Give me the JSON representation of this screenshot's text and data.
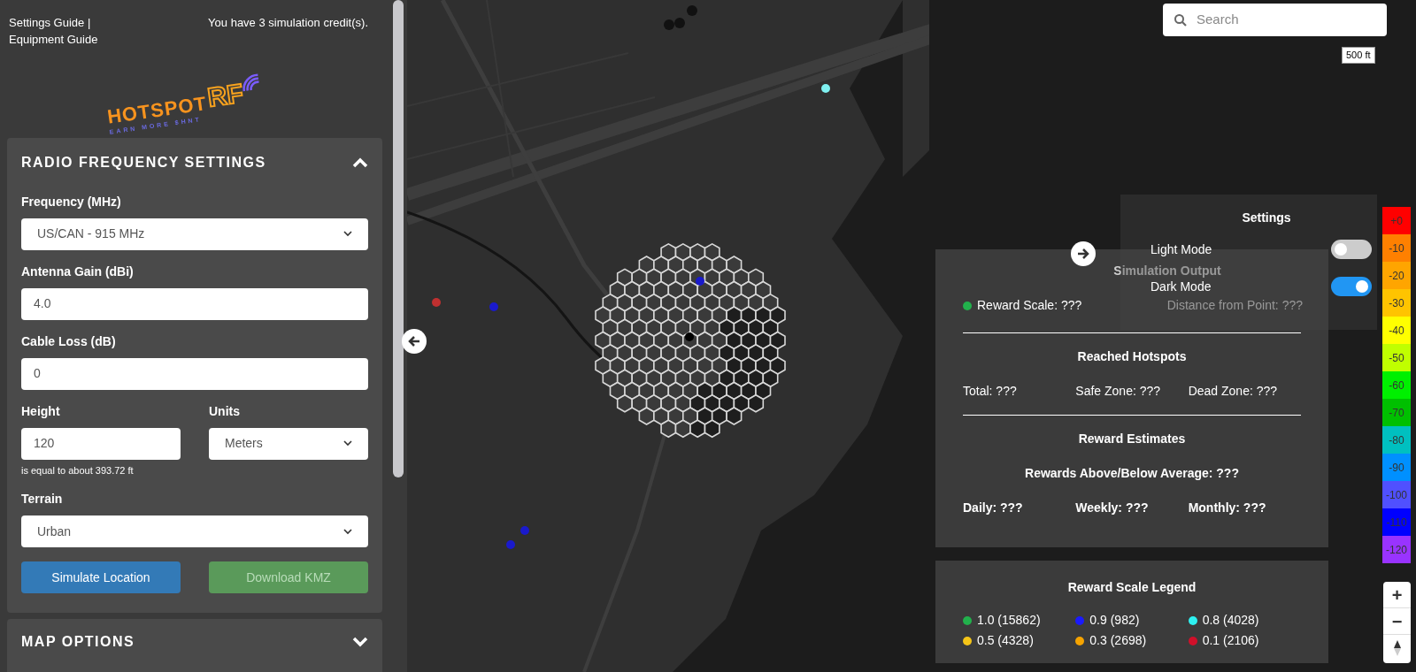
{
  "header": {
    "links": [
      "Settings Guide",
      "Equipment Guide"
    ],
    "separator": "|",
    "credits": "You have 3 simulation credit(s)."
  },
  "logo": {
    "word": "HOTSPOT",
    "accent": "RF",
    "tagline": "EARN MORE $HNT"
  },
  "rf_settings": {
    "title": "RADIO FREQUENCY SETTINGS",
    "expanded": true,
    "fields": [
      {
        "kind": "select",
        "label": "Frequency (MHz)",
        "value": "US/CAN - 915 MHz"
      },
      {
        "kind": "input",
        "label": "Antenna Gain (dBi)",
        "value": "4.0"
      },
      {
        "kind": "input",
        "label": "Cable Loss (dB)",
        "value": "0"
      },
      {
        "kind": "pair",
        "items": [
          {
            "kind": "input",
            "label": "Height",
            "value": "120",
            "note": "is equal to about 393.72 ft"
          },
          {
            "kind": "select",
            "label": "Units",
            "value": "Meters"
          }
        ]
      },
      {
        "kind": "select",
        "label": "Terrain",
        "value": "Urban"
      }
    ],
    "buttons": [
      {
        "label": "Simulate Location",
        "kind": "primary",
        "disabled": false
      },
      {
        "label": "Download KMZ",
        "kind": "success",
        "disabled": true
      }
    ]
  },
  "map_options": {
    "title": "MAP OPTIONS",
    "expanded": false
  },
  "search": {
    "placeholder": "Search"
  },
  "scale": "500 ft",
  "settings_panel": {
    "title": "Settings",
    "toggles": [
      {
        "label": "Light Mode",
        "on": false
      },
      {
        "label": "Dark Mode",
        "on": true
      }
    ]
  },
  "simulation_output": {
    "title": "Simulation Output",
    "reward_scale": {
      "label": "Reward Scale: ???",
      "color": "#22b14c"
    },
    "distance": "Distance from Point: ???",
    "reached_title": "Reached Hotspots",
    "reached": [
      "Total: ???",
      "Safe Zone: ???",
      "Dead Zone: ???"
    ],
    "estimates_title": "Reward Estimates",
    "average": "Rewards Above/Below Average: ???",
    "estimates": [
      "Daily: ???",
      "Weekly: ???",
      "Monthly: ???"
    ]
  },
  "signal_legend": [
    {
      "label": "+0",
      "color": "#ff0000"
    },
    {
      "label": "-10",
      "color": "#ff8000"
    },
    {
      "label": "-20",
      "color": "#ffa500"
    },
    {
      "label": "-30",
      "color": "#ffc400"
    },
    {
      "label": "-40",
      "color": "#ffff00"
    },
    {
      "label": "-50",
      "color": "#c0ff00"
    },
    {
      "label": "-60",
      "color": "#00f000"
    },
    {
      "label": "-70",
      "color": "#00c000"
    },
    {
      "label": "-80",
      "color": "#00c0c0"
    },
    {
      "label": "-90",
      "color": "#0090ff"
    },
    {
      "label": "-100",
      "color": "#5050ff"
    },
    {
      "label": "-110",
      "color": "#0000ff"
    },
    {
      "label": "-120",
      "color": "#9933ff"
    }
  ],
  "reward_legend": {
    "title": "Reward Scale Legend",
    "items": [
      {
        "label": "1.0 (15862)",
        "color": "#22b14c"
      },
      {
        "label": "0.9 (982)",
        "color": "#1a1aff"
      },
      {
        "label": "0.8 (4028)",
        "color": "#2ef0f0"
      },
      {
        "label": "0.5 (4328)",
        "color": "#f5c518"
      },
      {
        "label": "0.3 (2698)",
        "color": "#f5a300"
      },
      {
        "label": "0.1 (2106)",
        "color": "#d0102a"
      }
    ]
  },
  "zoom": {
    "in": "+",
    "out": "−"
  }
}
